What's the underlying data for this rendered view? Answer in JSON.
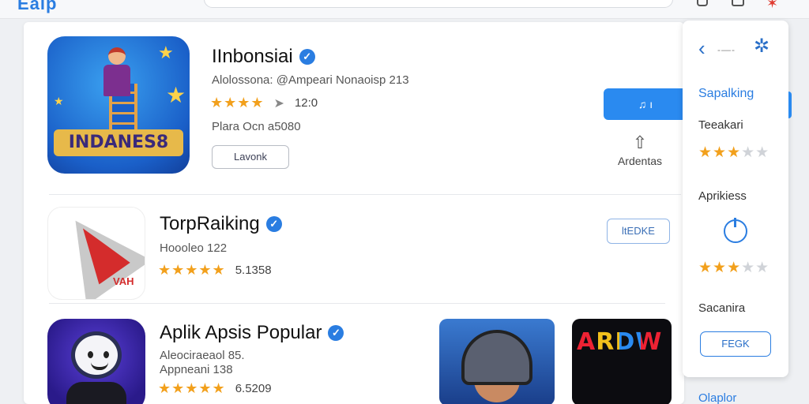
{
  "header": {
    "logo": "Eaip"
  },
  "apps": [
    {
      "name": "IInbonsiai",
      "meta_line1": "Alolossona: @Ampeari Nonaoisp 213",
      "rating_count": "12:0",
      "meta_line2": "Plara Ocn a5080",
      "button_label": "Lavonk",
      "icon_text": "INDANES8"
    },
    {
      "name": "TorpRaiking",
      "meta_line1": "Hoooleo 122",
      "rating_count": "5.1358",
      "button_label": "ltEDKE",
      "icon_text": "VAH"
    },
    {
      "name": "Aplik Apsis Popular",
      "meta_line1": "Aleociraeaol 85.",
      "meta_line2": "Appneani 138",
      "rating_count": "6.5209"
    }
  ],
  "actions": {
    "install_label": "♫ ı",
    "share_label": "Ardentas"
  },
  "thumbnails": {
    "t2_word": "ARDW"
  },
  "side_panel": {
    "dots": "-—-",
    "link_label": "Sapalking",
    "section1_label": "Teeakari",
    "section1_rating": 3,
    "section2_label": "Aprikiess",
    "section2_rating": 3,
    "section3_label": "Sacanira",
    "button_label": "FEGK"
  },
  "bottom_link": "Olaplor",
  "colors": {
    "accent": "#2a7de1",
    "star": "#f2a01c"
  }
}
